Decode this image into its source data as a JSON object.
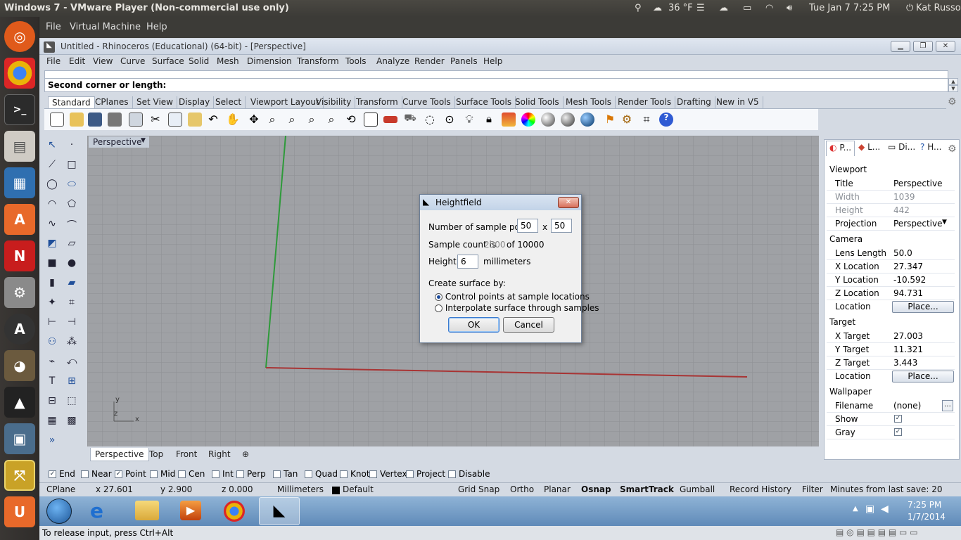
{
  "host": {
    "title": "Windows 7 - VMware Player (Non-commercial use only)",
    "weather": "36 °F",
    "datetime": "Tue Jan  7   7:25 PM",
    "user": "Kat Russo"
  },
  "vm_menu": [
    "File",
    "Virtual Machine",
    "Help"
  ],
  "rhino": {
    "title": "Untitled - Rhinoceros (Educational) (64-bit) - [Perspective]",
    "menu": [
      "File",
      "Edit",
      "View",
      "Curve",
      "Surface",
      "Solid",
      "Mesh",
      "Dimension",
      "Transform",
      "Tools",
      "Analyze",
      "Render",
      "Panels",
      "Help"
    ],
    "command_prompt": "Second corner or length:",
    "toolbar_tabs": [
      "Standard",
      "CPlanes",
      "Set View",
      "Display",
      "Select",
      "Viewport Layout",
      "Visibility",
      "Transform",
      "Curve Tools",
      "Surface Tools",
      "Solid Tools",
      "Mesh Tools",
      "Render Tools",
      "Drafting",
      "New in V5"
    ],
    "viewport_label": "Perspective",
    "viewport_tabs": [
      "Perspective",
      "Top",
      "Front",
      "Right"
    ],
    "axis_y": "y",
    "axis_z": "z",
    "axis_x": "x",
    "osnaps": [
      {
        "label": "End",
        "checked": true
      },
      {
        "label": "Near",
        "checked": false
      },
      {
        "label": "Point",
        "checked": true
      },
      {
        "label": "Mid",
        "checked": false
      },
      {
        "label": "Cen",
        "checked": false
      },
      {
        "label": "Int",
        "checked": false
      },
      {
        "label": "Perp",
        "checked": false
      },
      {
        "label": "Tan",
        "checked": false
      },
      {
        "label": "Quad",
        "checked": false
      },
      {
        "label": "Knot",
        "checked": false
      },
      {
        "label": "Vertex",
        "checked": false
      },
      {
        "label": "Project",
        "checked": false
      },
      {
        "label": "Disable",
        "checked": false
      }
    ],
    "status": {
      "cplane": "CPlane",
      "x": "x 27.601",
      "y": "y 2.900",
      "z": "z 0.000",
      "units": "Millimeters",
      "layer": "Default",
      "toggles": [
        "Grid Snap",
        "Ortho",
        "Planar",
        "Osnap",
        "SmartTrack",
        "Gumball",
        "Record History",
        "Filter"
      ],
      "last_save": "Minutes from last save: 20"
    },
    "panel_tabs": [
      "P...",
      "L...",
      "Di...",
      "H..."
    ],
    "properties": {
      "viewport_header": "Viewport",
      "title_k": "Title",
      "title_v": "Perspective",
      "width_k": "Width",
      "width_v": "1039",
      "height_k": "Height",
      "height_v": "442",
      "projection_k": "Projection",
      "projection_v": "Perspective",
      "camera_header": "Camera",
      "lens_k": "Lens Length",
      "lens_v": "50.0",
      "xloc_k": "X Location",
      "xloc_v": "27.347",
      "yloc_k": "Y Location",
      "yloc_v": "-10.592",
      "zloc_k": "Z Location",
      "zloc_v": "94.731",
      "location_k": "Location",
      "place_label": "Place...",
      "target_header": "Target",
      "xt_k": "X Target",
      "xt_v": "27.003",
      "yt_k": "Y Target",
      "yt_v": "11.321",
      "zt_k": "Z Target",
      "zt_v": "3.443",
      "wallpaper_header": "Wallpaper",
      "filename_k": "Filename",
      "filename_v": "(none)",
      "show_k": "Show",
      "gray_k": "Gray",
      "ellipsis": "..."
    }
  },
  "dialog": {
    "title": "Heightfield",
    "samples_label": "Number of sample points:",
    "samples_x": "50",
    "times": "x",
    "samples_y": "50",
    "count_label": "Sample count is",
    "count_value": "2500",
    "count_of": "of 10000",
    "height_label": "Height:",
    "height_value": "6",
    "height_units": "millimeters",
    "create_label": "Create surface by:",
    "opt1": "Control points at sample locations",
    "opt2": "Interpolate surface through samples",
    "ok": "OK",
    "cancel": "Cancel"
  },
  "taskbar": {
    "time": "7:25 PM",
    "date": "1/7/2014"
  },
  "vm_status": "To release input, press Ctrl+Alt"
}
